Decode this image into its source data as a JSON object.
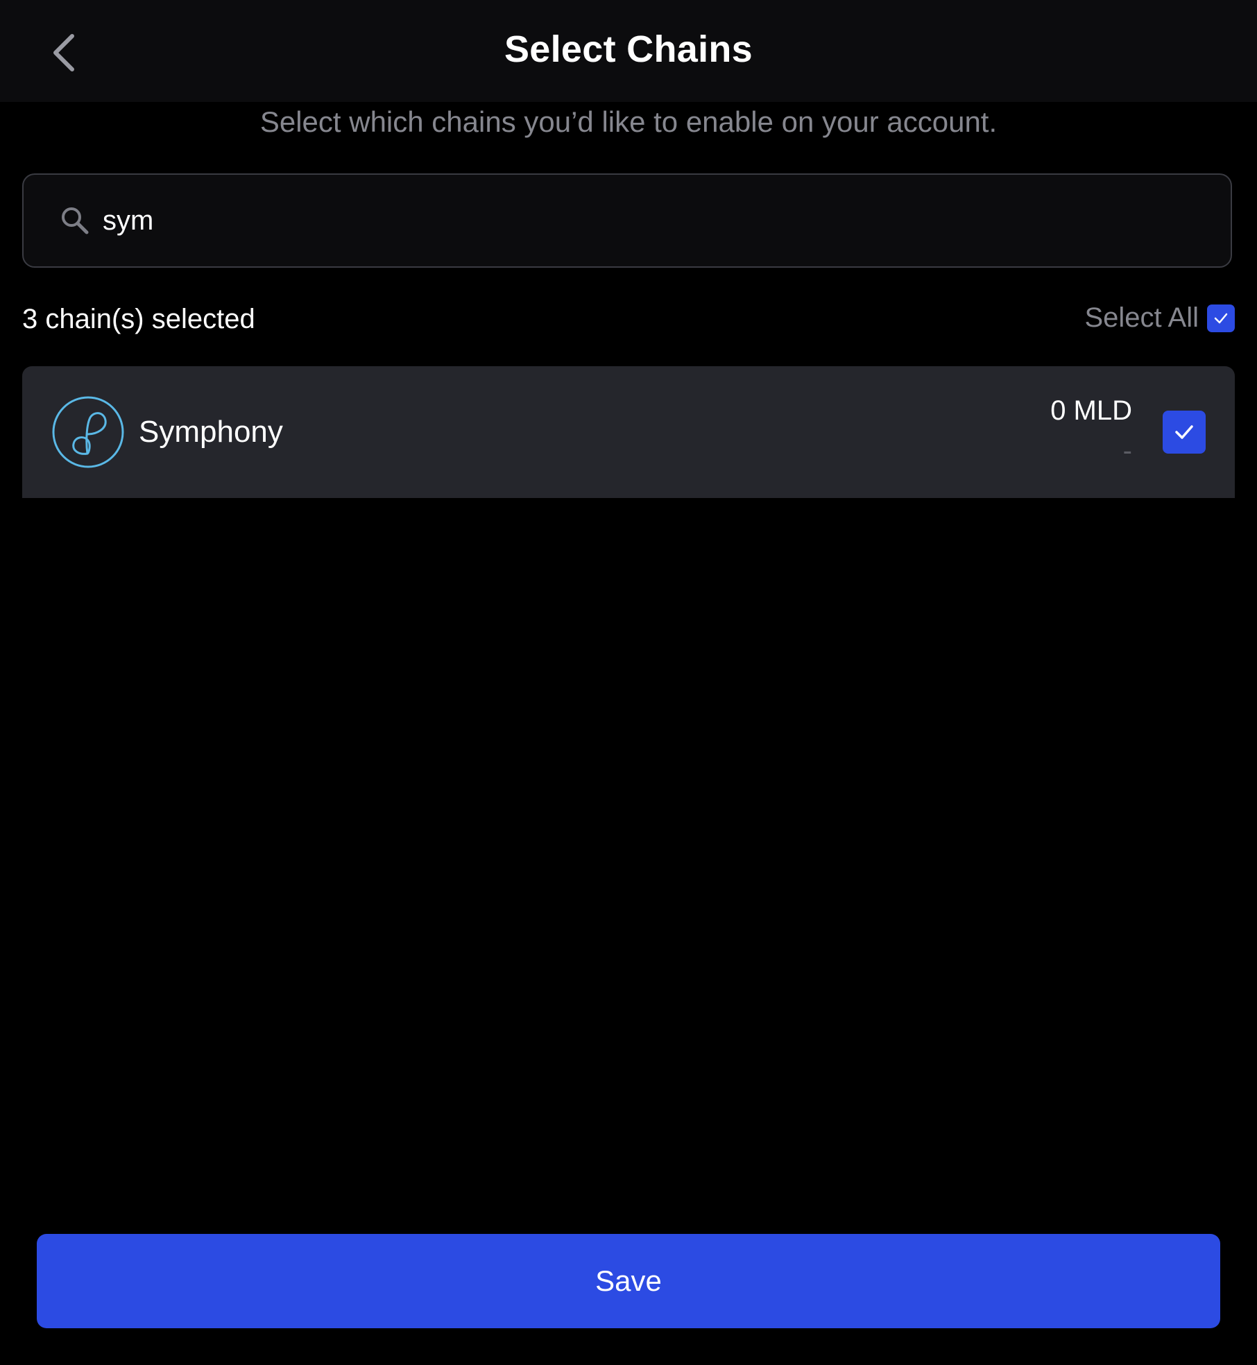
{
  "header": {
    "title": "Select Chains",
    "back_icon": "chevron-left-icon"
  },
  "subtitle": "Select which chains you’d like to enable on your account.",
  "search": {
    "value": "sym",
    "icon": "search-icon"
  },
  "selection": {
    "count_label": "3 chain(s) selected",
    "select_all_label": "Select All",
    "select_all_checked": true
  },
  "chains": [
    {
      "name": "Symphony",
      "balance": "0 MLD",
      "value": "-",
      "checked": true,
      "logo_color": "#5ab8e6"
    }
  ],
  "footer": {
    "save_label": "Save"
  },
  "colors": {
    "accent": "#2c4be3",
    "background": "#000000",
    "header": "#0c0c0e",
    "row": "#25262c",
    "muted_text": "#86878f"
  }
}
